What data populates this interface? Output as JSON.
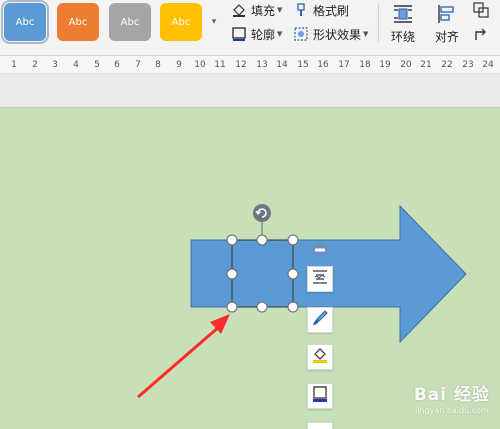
{
  "ribbon": {
    "styles": [
      {
        "label": "Abc",
        "color": "#5b9bd5"
      },
      {
        "label": "Abc",
        "color": "#ed7d31"
      },
      {
        "label": "Abc",
        "color": "#a5a5a5"
      },
      {
        "label": "Abc",
        "color": "#ffc000"
      }
    ],
    "fill_label": "填充",
    "format_painter_label": "格式刷",
    "outline_label": "轮廓",
    "shape_effects_label": "形状效果",
    "wrap_label": "环绕",
    "align_label": "对齐"
  },
  "ruler": {
    "ticks": [
      "1",
      "2",
      "3",
      "4",
      "5",
      "6",
      "7",
      "8",
      "9",
      "10",
      "11",
      "12",
      "13",
      "14",
      "15",
      "16",
      "17",
      "18",
      "19",
      "20",
      "21",
      "22",
      "23",
      "24"
    ]
  },
  "canvas": {
    "arrow_color": "#5b9bd5",
    "arrow_stroke": "#3f6f9f",
    "pointer_color": "#ff2a2a",
    "side_buttons": [
      "wrap-text-icon",
      "brush-icon",
      "fill-icon",
      "outline-icon"
    ]
  },
  "watermark": {
    "logo": "Bai 经验",
    "sub": "jingyan.baidu.com"
  }
}
